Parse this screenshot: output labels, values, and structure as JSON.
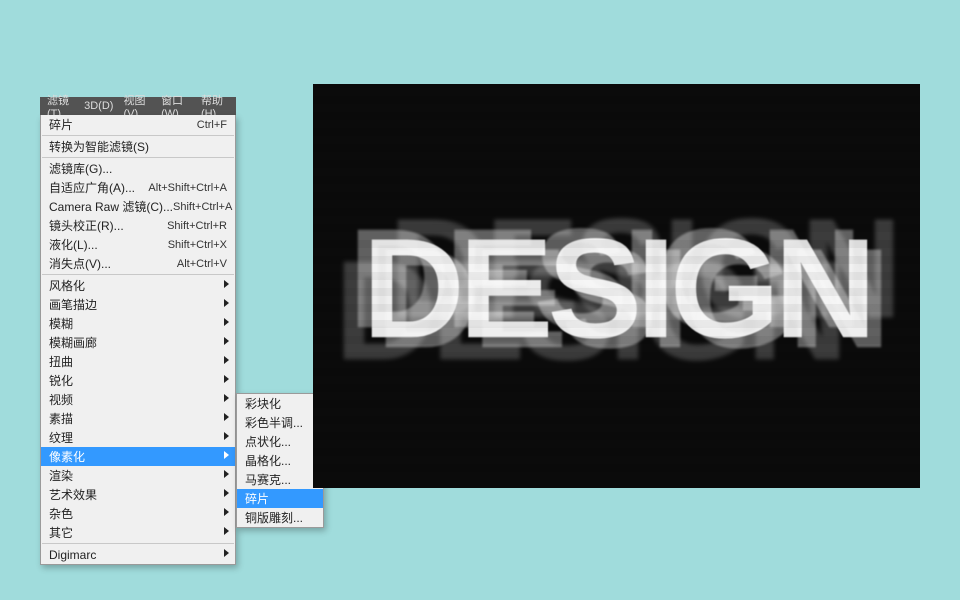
{
  "menubar": {
    "items": [
      "滤镜(T)",
      "3D(D)",
      "视图(V)",
      "窗口(W)",
      "帮助(H)"
    ]
  },
  "dropdown": {
    "groups": [
      [
        {
          "label": "碎片",
          "shortcut": "Ctrl+F"
        }
      ],
      [
        {
          "label": "转换为智能滤镜(S)"
        }
      ],
      [
        {
          "label": "滤镜库(G)..."
        },
        {
          "label": "自适应广角(A)...",
          "shortcut": "Alt+Shift+Ctrl+A"
        },
        {
          "label": "Camera Raw 滤镜(C)...",
          "shortcut": "Shift+Ctrl+A"
        },
        {
          "label": "镜头校正(R)...",
          "shortcut": "Shift+Ctrl+R"
        },
        {
          "label": "液化(L)...",
          "shortcut": "Shift+Ctrl+X"
        },
        {
          "label": "消失点(V)...",
          "shortcut": "Alt+Ctrl+V"
        }
      ],
      [
        {
          "label": "风格化",
          "submenu": true
        },
        {
          "label": "画笔描边",
          "submenu": true
        },
        {
          "label": "模糊",
          "submenu": true
        },
        {
          "label": "模糊画廊",
          "submenu": true
        },
        {
          "label": "扭曲",
          "submenu": true
        },
        {
          "label": "锐化",
          "submenu": true
        },
        {
          "label": "视频",
          "submenu": true
        },
        {
          "label": "素描",
          "submenu": true
        },
        {
          "label": "纹理",
          "submenu": true
        },
        {
          "label": "像素化",
          "submenu": true,
          "selected": true
        },
        {
          "label": "渲染",
          "submenu": true
        },
        {
          "label": "艺术效果",
          "submenu": true
        },
        {
          "label": "杂色",
          "submenu": true
        },
        {
          "label": "其它",
          "submenu": true
        }
      ],
      [
        {
          "label": "Digimarc",
          "submenu": true
        }
      ]
    ]
  },
  "submenu": {
    "items": [
      {
        "label": "彩块化"
      },
      {
        "label": "彩色半调..."
      },
      {
        "label": "点状化..."
      },
      {
        "label": "晶格化..."
      },
      {
        "label": "马赛克..."
      },
      {
        "label": "碎片",
        "selected": true
      },
      {
        "label": "铜版雕刻..."
      }
    ]
  },
  "canvas": {
    "text": "DESIGN"
  }
}
